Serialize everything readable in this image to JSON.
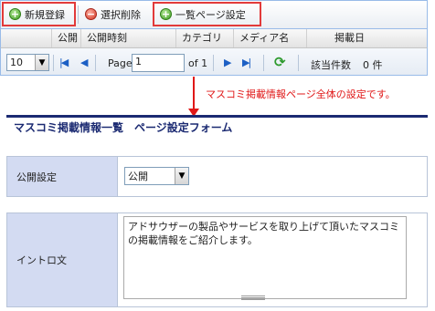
{
  "toolbar": {
    "new_label": "新規登録",
    "delete_label": "選択削除",
    "list_settings_label": "一覧ページ設定"
  },
  "grid": {
    "columns": [
      "公開",
      "公開時刻",
      "カテゴリ",
      "メディア名",
      "掲載日"
    ]
  },
  "paging": {
    "page_size": "10",
    "page_label": "Page",
    "page_value": "1",
    "of_label": "of 1",
    "total_label": "該当件数",
    "total_value": "0 件"
  },
  "annotation": {
    "text": "マスコミ掲載情報ページ全体の設定です。"
  },
  "form": {
    "title": "マスコミ掲載情報一覧　ページ設定フォーム",
    "publish_label": "公開設定",
    "publish_value": "公開",
    "intro_label": "イントロ文",
    "intro_value": "アドサウザーの製品やサービスを取り上げて頂いたマスコミの掲載情報をご紹介します。"
  },
  "colors": {
    "annotation": "#e01818",
    "form_title": "#1b2a72",
    "label_bg": "#d3dbf2"
  }
}
